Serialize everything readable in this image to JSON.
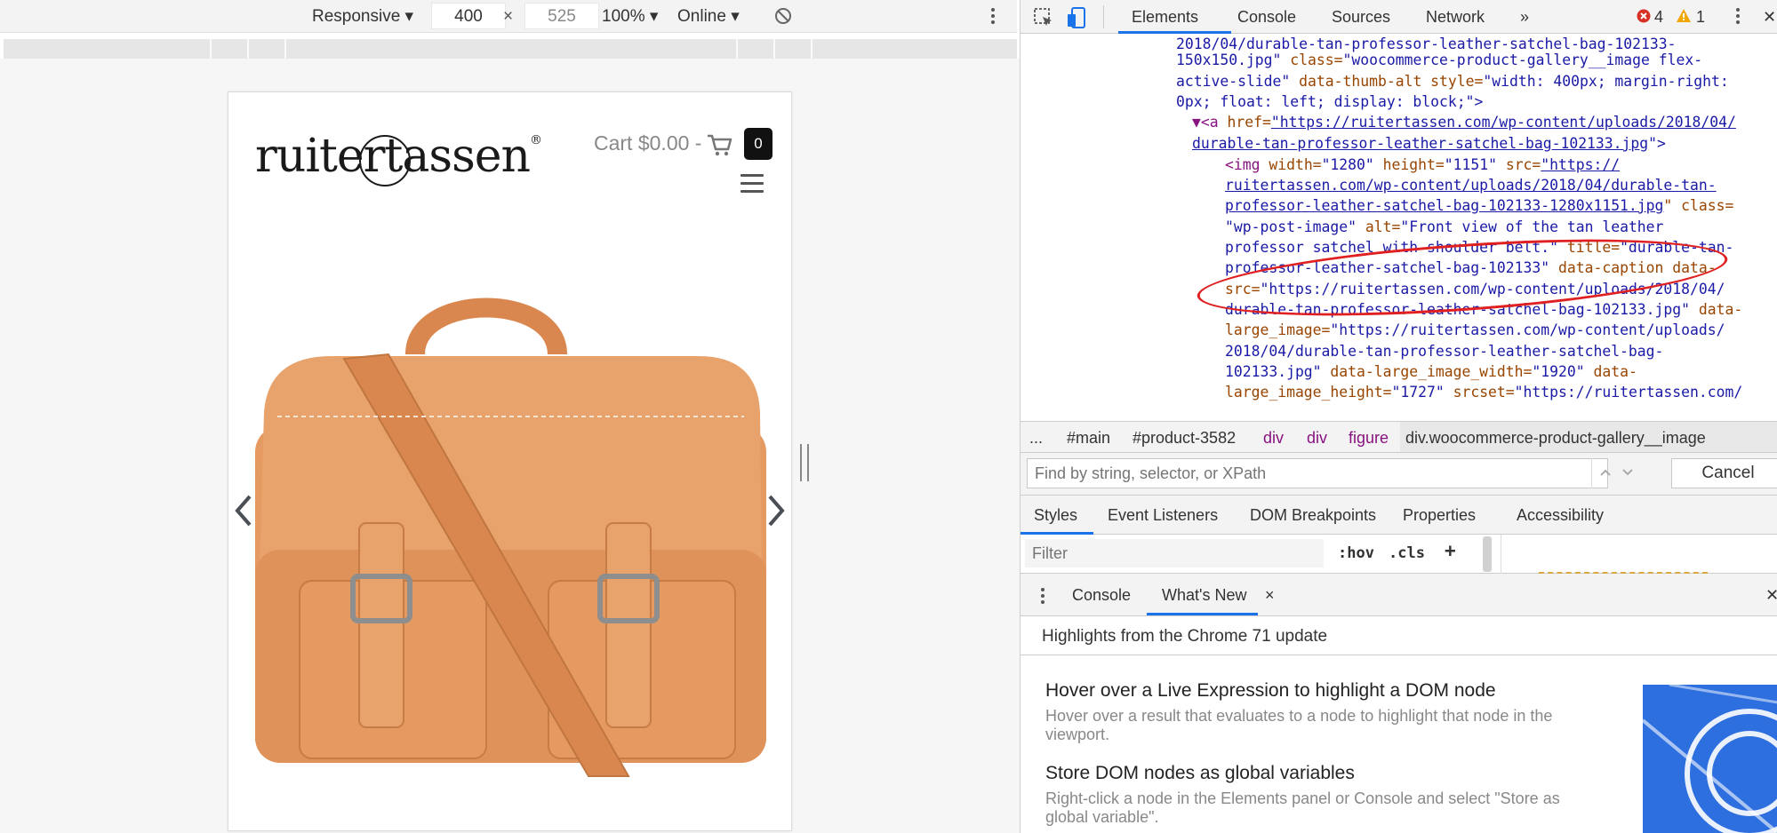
{
  "device_toolbar": {
    "device": "Responsive",
    "width": "400",
    "times": "×",
    "height": "525",
    "zoom": "100%",
    "throttle": "Online",
    "rotate_icon": "rotate-icon",
    "more_icon": "kebab-icon"
  },
  "page": {
    "logo": "ruitertassen",
    "logo_mark": "®",
    "cart_label": "Cart $0.00 -",
    "cart_count": "0",
    "cart_icon": "cart-icon",
    "menu_icon": "hamburger-icon",
    "prev_icon": "chevron-left-icon",
    "next_icon": "chevron-right-icon",
    "product_color": "#e59a62"
  },
  "devtools": {
    "tabs": [
      "Elements",
      "Console",
      "Sources",
      "Network",
      "»"
    ],
    "errors": "4",
    "warnings": "1",
    "dom_lines": {
      "l1": "2018/04/durable-tan-professor-leather-satchel-bag-102133-",
      "l2a": "150x150.jpg\"",
      "l2b": " class=",
      "l2c": "\"woocommerce-product-gallery__image flex-",
      "l3a": "active-slide\"",
      "l3b": " data-thumb-alt style=",
      "l3c": "\"width: 400px; margin-right:",
      "l4": "0px; float: left; display: block;\">",
      "l5a": "▼<a ",
      "l5b": "href=",
      "l5c": "\"https://ruitertassen.com/wp-content/uploads/2018/04/",
      "l6": "durable-tan-professor-leather-satchel-bag-102133.jpg",
      "l6b": "\">",
      "l7a": "<img ",
      "l7b": "width=",
      "l7c": "\"1280\"",
      "l7d": " height=",
      "l7e": "\"1151\"",
      "l7f": " src=",
      "l7g": "\"https://",
      "l8": "ruitertassen.com/wp-content/uploads/2018/04/durable-tan-",
      "l9a": "professor-leather-satchel-bag-102133-1280x1151.jpg",
      "l9b": "\" class=",
      "l10a": "\"wp-post-image\"",
      "l10b": " alt=",
      "l10c": "\"Front view of the tan leather",
      "l11a": "professor satchel with shoulder belt.\"",
      "l11b": " title=",
      "l11c": "\"durable-tan-",
      "l12a": "professor-leather-satchel-bag-102133\"",
      "l12b": " data-caption data-",
      "l13a": "src=",
      "l13b": "\"https://ruitertassen.com/wp-content/uploads/2018/04/",
      "l14a": "durable-tan-professor-leather-satchel-bag-102133.jpg\"",
      "l14b": " data-",
      "l15a": "large_image=",
      "l15b": "\"https://ruitertassen.com/wp-content/uploads/",
      "l16": "2018/04/durable-tan-professor-leather-satchel-bag-",
      "l17a": "102133.jpg\"",
      "l17b": " data-large_image_width=",
      "l17c": "\"1920\"",
      "l17d": " data-",
      "l18a": "large_image_height=",
      "l18b": "\"1727\"",
      "l18c": " srcset=",
      "l18d": "\"https://ruitertassen.com/"
    },
    "breadcrumbs": [
      "...",
      "#main",
      "#product-3582",
      "div",
      "div",
      "figure",
      "div.woocommerce-product-gallery__image"
    ],
    "search_placeholder": "Find by string, selector, or XPath",
    "cancel": "Cancel",
    "sub_tabs": [
      "Styles",
      "Event Listeners",
      "DOM Breakpoints",
      "Properties",
      "Accessibility"
    ],
    "filter_placeholder": "Filter",
    "hov": ":hov",
    "cls": ".cls",
    "plus": "+",
    "drawer_tabs": [
      "Console",
      "What's New"
    ],
    "drawer_close": "×",
    "highlights": "Highlights from the Chrome 71 update",
    "whats_new": [
      {
        "title": "Hover over a Live Expression to highlight a DOM node",
        "body": "Hover over a result that evaluates to a node to highlight that node in the viewport."
      },
      {
        "title": "Store DOM nodes as global variables",
        "body": "Right-click a node in the Elements panel or Console and select \"Store as global variable\"."
      }
    ],
    "accent_color": "#1a73e8",
    "error_color": "#d93025",
    "warning_color": "#f2a600"
  }
}
